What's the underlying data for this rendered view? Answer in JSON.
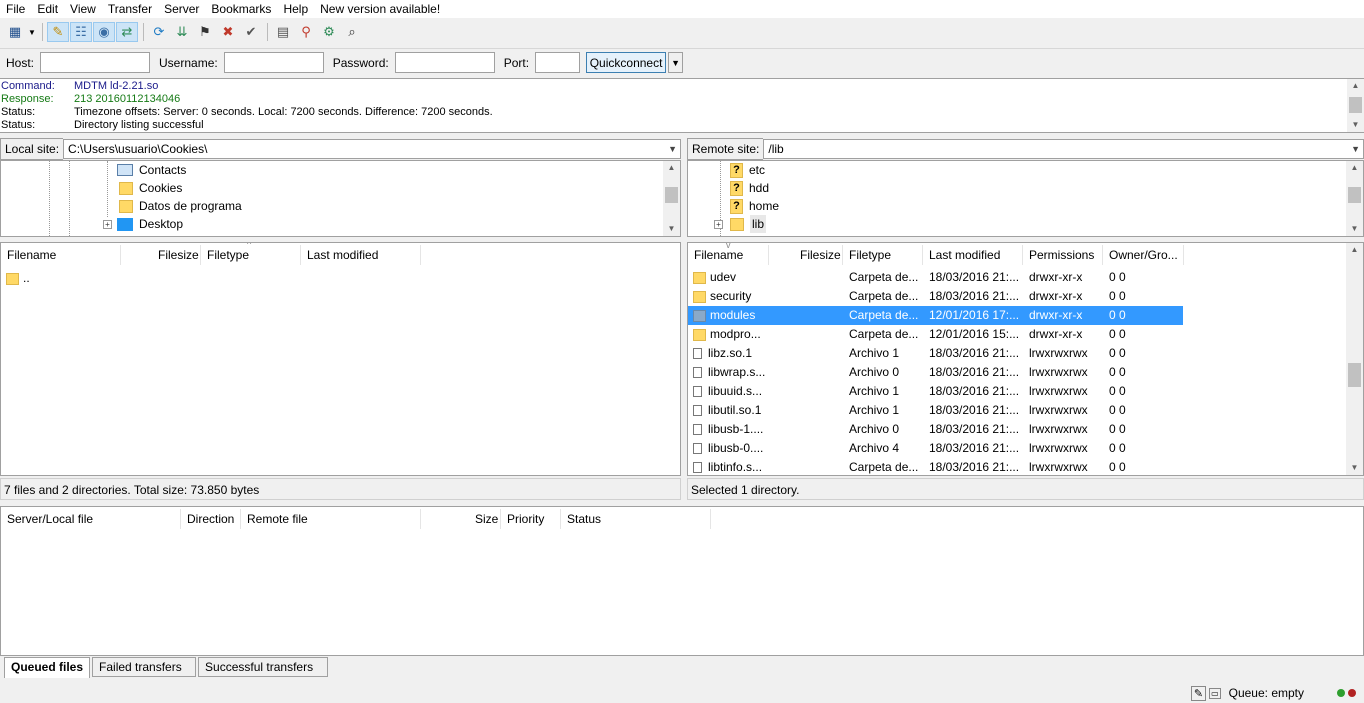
{
  "menu": [
    "File",
    "Edit",
    "View",
    "Transfer",
    "Server",
    "Bookmarks",
    "Help",
    "New version available!"
  ],
  "toolbar": {
    "icons": [
      "site-manager-icon",
      "toggle-log-icon",
      "toggle-local-tree-icon",
      "toggle-remote-tree-icon",
      "toggle-queue-icon",
      "refresh-icon",
      "process-queue-icon",
      "cancel-icon",
      "disconnect-icon",
      "reconnect-icon",
      "filter-icon",
      "sync-browse-icon",
      "compare-icon",
      "search-icon"
    ]
  },
  "quickconnect": {
    "host_label": "Host:",
    "host_value": "",
    "username_label": "Username:",
    "username_value": "",
    "password_label": "Password:",
    "password_value": "",
    "port_label": "Port:",
    "port_value": "",
    "button": "Quickconnect"
  },
  "log": [
    {
      "key": "Command:",
      "value": "MDTM ld-2.21.so",
      "type": "cmd"
    },
    {
      "key": "Response:",
      "value": "213 20160112134046",
      "type": "resp"
    },
    {
      "key": "Status:",
      "value": "Timezone offsets: Server: 0 seconds. Local: 7200 seconds. Difference: 7200 seconds.",
      "type": "status"
    },
    {
      "key": "Status:",
      "value": "Directory listing successful",
      "type": "status"
    }
  ],
  "local": {
    "site_label": "Local site:",
    "path": "C:\\Users\\usuario\\Cookies\\",
    "tree": [
      "Contacts",
      "Cookies",
      "Datos de programa",
      "Desktop"
    ],
    "headers": [
      "Filename",
      "Filesize",
      "Filetype",
      "Last modified"
    ],
    "files": [
      ".."
    ],
    "status": "7 files and 2 directories. Total size: 73.850 bytes"
  },
  "remote": {
    "site_label": "Remote site:",
    "path": "/lib",
    "tree": [
      "etc",
      "hdd",
      "home",
      "lib"
    ],
    "headers": [
      "Filename",
      "Filesize",
      "Filetype",
      "Last modified",
      "Permissions",
      "Owner/Gro..."
    ],
    "files": [
      {
        "name": "udev",
        "type": "Carpeta de...",
        "modified": "18/03/2016 21:...",
        "perms": "drwxr-xr-x",
        "owner": "0 0",
        "kind": "folder"
      },
      {
        "name": "security",
        "type": "Carpeta de...",
        "modified": "18/03/2016 21:...",
        "perms": "drwxr-xr-x",
        "owner": "0 0",
        "kind": "folder"
      },
      {
        "name": "modules",
        "type": "Carpeta de...",
        "modified": "12/01/2016 17:...",
        "perms": "drwxr-xr-x",
        "owner": "0 0",
        "kind": "folder"
      },
      {
        "name": "modpro...",
        "type": "Carpeta de...",
        "modified": "12/01/2016 15:...",
        "perms": "drwxr-xr-x",
        "owner": "0 0",
        "kind": "folder"
      },
      {
        "name": "libz.so.1",
        "type": "Archivo 1",
        "modified": "18/03/2016 21:...",
        "perms": "lrwxrwxrwx",
        "owner": "0 0",
        "kind": "link"
      },
      {
        "name": "libwrap.s...",
        "type": "Archivo 0",
        "modified": "18/03/2016 21:...",
        "perms": "lrwxrwxrwx",
        "owner": "0 0",
        "kind": "link"
      },
      {
        "name": "libuuid.s...",
        "type": "Archivo 1",
        "modified": "18/03/2016 21:...",
        "perms": "lrwxrwxrwx",
        "owner": "0 0",
        "kind": "link"
      },
      {
        "name": "libutil.so.1",
        "type": "Archivo 1",
        "modified": "18/03/2016 21:...",
        "perms": "lrwxrwxrwx",
        "owner": "0 0",
        "kind": "link"
      },
      {
        "name": "libusb-1....",
        "type": "Archivo 0",
        "modified": "18/03/2016 21:...",
        "perms": "lrwxrwxrwx",
        "owner": "0 0",
        "kind": "link"
      },
      {
        "name": "libusb-0....",
        "type": "Archivo 4",
        "modified": "18/03/2016 21:...",
        "perms": "lrwxrwxrwx",
        "owner": "0 0",
        "kind": "link"
      },
      {
        "name": "libtinfo.s...",
        "type": "Carpeta de...",
        "modified": "18/03/2016 21:...",
        "perms": "lrwxrwxrwx",
        "owner": "0 0",
        "kind": "link"
      }
    ],
    "selected_index": 2,
    "status": "Selected 1 directory."
  },
  "queue": {
    "headers": [
      "Server/Local file",
      "Direction",
      "Remote file",
      "Size",
      "Priority",
      "Status"
    ],
    "tabs": [
      "Queued files",
      "Failed transfers",
      "Successful transfers"
    ],
    "status": "Queue: empty"
  },
  "colors": {
    "selection": "#3399ff",
    "command": "#1a1a8a",
    "response": "#157a15",
    "led_green": "#2e9e2e",
    "led_red": "#b22222"
  }
}
